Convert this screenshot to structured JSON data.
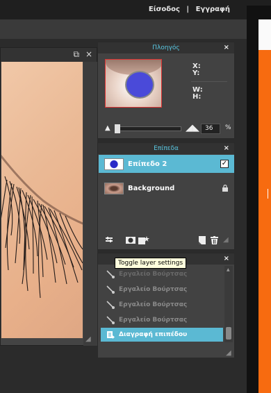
{
  "topbar": {
    "login": "Είσοδος",
    "separator": "|",
    "register": "Εγγραφή"
  },
  "canvas": {
    "restore_glyph": "⧉",
    "close_glyph": "×"
  },
  "navigator": {
    "title": "Πλοηγός",
    "close": "×",
    "x_label": "X:",
    "y_label": "Y:",
    "w_label": "W:",
    "h_label": "H:",
    "zoom_value": "36",
    "zoom_unit": "%",
    "zoom_min_glyph": "▲",
    "zoom_max_glyph": "◢◣"
  },
  "layers": {
    "title": "Επίπεδα",
    "close": "×",
    "items": [
      {
        "name": "Επίπεδο 2",
        "selected": true,
        "visible_check": "✓"
      },
      {
        "name": "Background",
        "locked": true,
        "lock_glyph": "🔒"
      }
    ],
    "tools": {
      "settings": "☷",
      "mask": "▣",
      "effects": "✦",
      "new": "▮",
      "delete": "🗑",
      "grip": "◢"
    }
  },
  "tooltip": "Toggle layer settings",
  "history": {
    "close": "×",
    "items": [
      {
        "label": "Εργαλείο Βούρτσας"
      },
      {
        "label": "Εργαλείο Βούρτσας"
      },
      {
        "label": "Εργαλείο Βούρτσας"
      },
      {
        "label": "Εργαλείο Βούρτσας"
      },
      {
        "label": "Διαγραφή επιπέδου",
        "selected": true
      }
    ]
  },
  "colors": {
    "accent": "#5bb9d3",
    "header_text": "#59c8e3",
    "orange": "#f76b10"
  }
}
